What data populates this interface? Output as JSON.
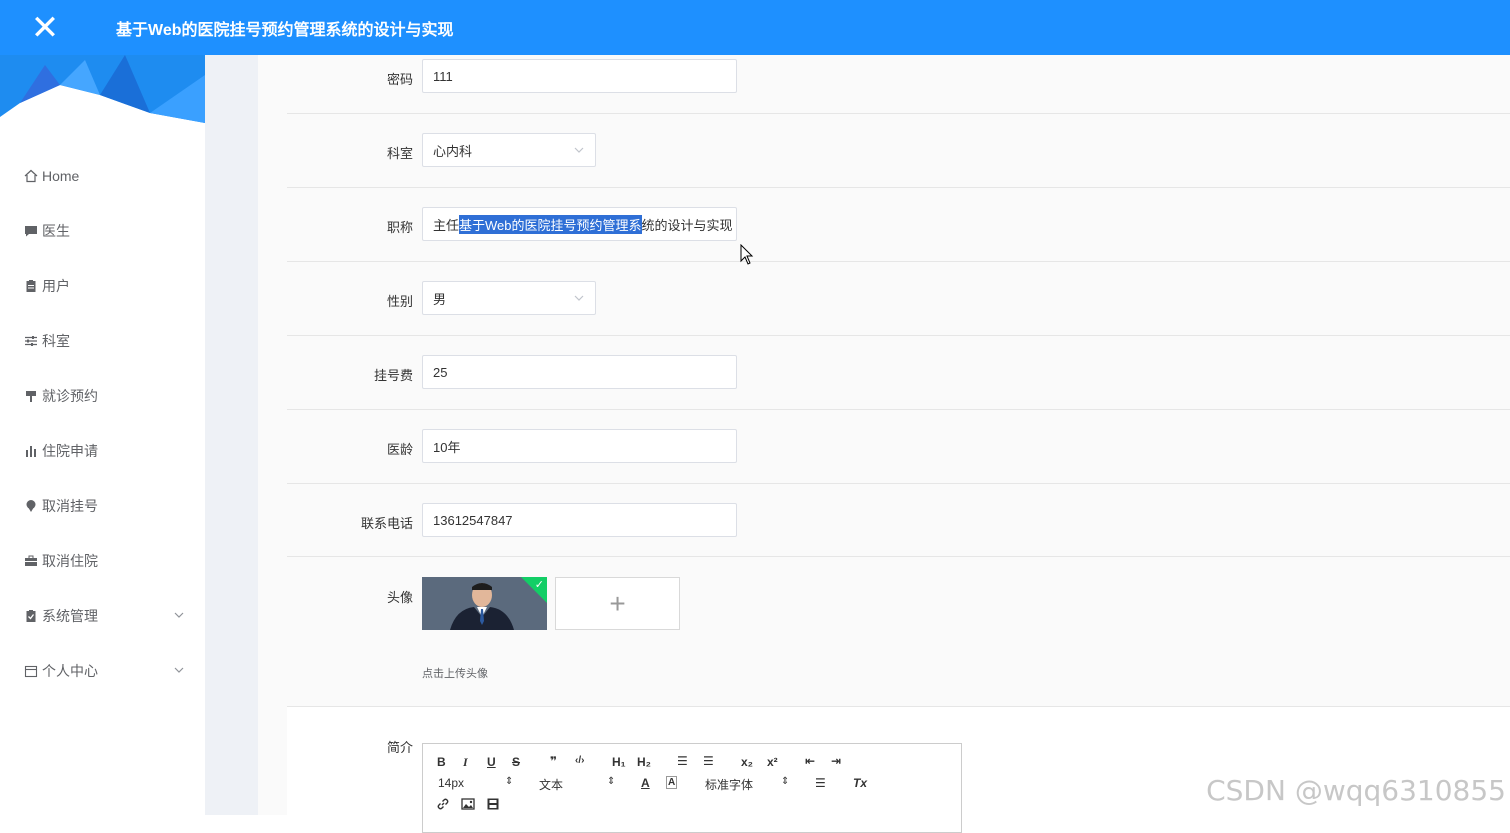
{
  "header": {
    "title": "基于Web的医院挂号预约管理系统的设计与实现",
    "close_icon": "close-icon"
  },
  "sidebar": {
    "items": [
      {
        "label": "Home",
        "icon": "home-icon"
      },
      {
        "label": "医生",
        "icon": "chat-icon"
      },
      {
        "label": "用户",
        "icon": "clipboard-icon"
      },
      {
        "label": "科室",
        "icon": "sliders-icon"
      },
      {
        "label": "就诊预约",
        "icon": "sign-icon"
      },
      {
        "label": "住院申请",
        "icon": "bar-chart-icon"
      },
      {
        "label": "取消挂号",
        "icon": "pin-icon"
      },
      {
        "label": "取消住院",
        "icon": "briefcase-icon"
      },
      {
        "label": "系统管理",
        "icon": "clipboard-check-icon",
        "expandable": true
      },
      {
        "label": "个人中心",
        "icon": "calendar-icon",
        "expandable": true
      }
    ]
  },
  "form": {
    "password": {
      "label": "密码",
      "value": "111"
    },
    "department": {
      "label": "科室",
      "value": "心内科"
    },
    "title": {
      "label": "职称",
      "value_prefix": "主任",
      "value_selected": "基于Web的医院挂号预约管理系",
      "value_suffix": "统的设计与实现"
    },
    "gender": {
      "label": "性别",
      "value": "男"
    },
    "fee": {
      "label": "挂号费",
      "value": "25"
    },
    "seniority": {
      "label": "医龄",
      "value": "10年"
    },
    "phone": {
      "label": "联系电话",
      "value": "13612547847"
    },
    "avatar": {
      "label": "头像",
      "hint": "点击上传头像",
      "add": "+"
    },
    "intro": {
      "label": "简介",
      "toolbar": {
        "bold": "B",
        "italic": "I",
        "underline": "U",
        "strike": "S",
        "quote": "❞",
        "code": "‹/›",
        "h1": "H₁",
        "h2": "H₂",
        "ol": "☰",
        "ul": "☰",
        "sub": "x₂",
        "sup": "x²",
        "outdent": "⇤",
        "indent": "⇥",
        "size": "14px",
        "header": "文本",
        "color": "A",
        "bg": "A",
        "font": "标准字体",
        "align": "☰",
        "clean": "Tx",
        "link": "🔗",
        "image": "🖼",
        "video": "▣"
      }
    }
  },
  "watermark": "CSDN @wqq6310855"
}
